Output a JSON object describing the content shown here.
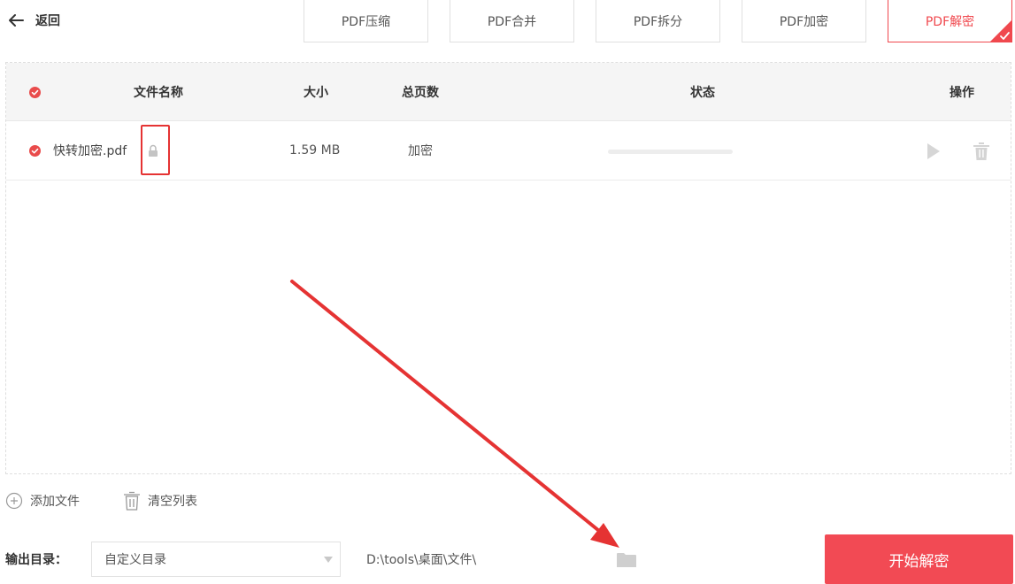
{
  "back": {
    "label": "返回"
  },
  "tabs": [
    {
      "label": "PDF压缩",
      "active": false
    },
    {
      "label": "PDF合并",
      "active": false
    },
    {
      "label": "PDF拆分",
      "active": false
    },
    {
      "label": "PDF加密",
      "active": false
    },
    {
      "label": "PDF解密",
      "active": true
    }
  ],
  "table": {
    "headers": {
      "name": "文件名称",
      "size": "大小",
      "pages": "总页数",
      "status": "状态",
      "actions": "操作"
    },
    "rows": [
      {
        "name": "快转加密.pdf",
        "size": "1.59 MB",
        "pages": "加密",
        "progress": 0,
        "locked": true
      }
    ]
  },
  "toolbar": {
    "add_label": "添加文件",
    "clear_label": "清空列表"
  },
  "output": {
    "label": "输出目录：",
    "mode": "自定义目录",
    "path": "D:\\tools\\桌面\\文件\\"
  },
  "start_button": {
    "label": "开始解密"
  },
  "colors": {
    "accent": "#f24a54",
    "check_red": "#e94b4b",
    "annotation_red": "#e53333"
  },
  "icons": [
    "back-arrow-icon",
    "corner-check-icon",
    "check-circle-icon",
    "lock-icon",
    "play-icon",
    "trash-icon",
    "add-circle-icon",
    "clear-trash-icon",
    "dropdown-caret-icon",
    "folder-icon"
  ]
}
